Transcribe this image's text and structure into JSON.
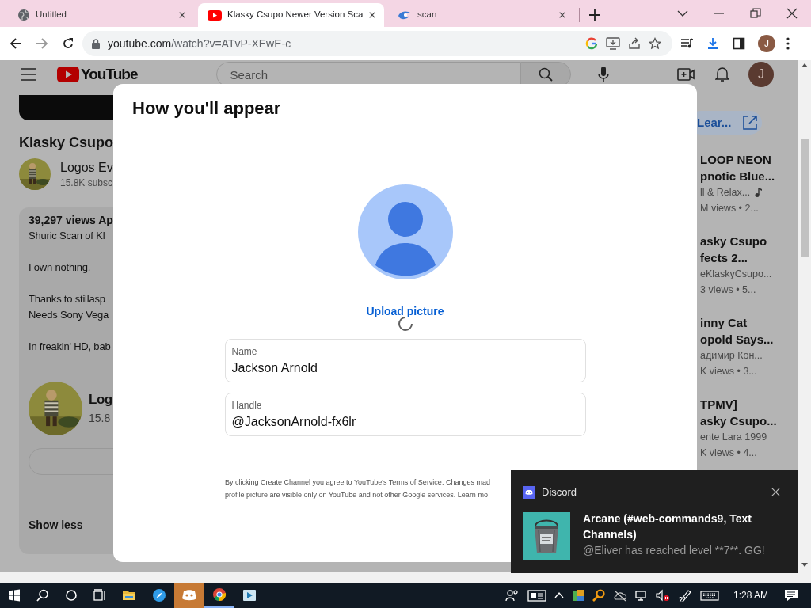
{
  "browser": {
    "tabs": [
      {
        "title": "Untitled",
        "kind": "globe",
        "selected": false
      },
      {
        "title": "Klasky Csupo Newer Version Sca",
        "kind": "youtube",
        "selected": true
      },
      {
        "title": "scan",
        "kind": "swirl",
        "selected": false
      }
    ],
    "url": {
      "host": "youtube.com",
      "path": "/watch?v=ATvP-XEwE-c"
    },
    "profile_initial": "J"
  },
  "youtube": {
    "logo": "YouTube",
    "search_placeholder": "Search",
    "avatar_initial": "J",
    "video_title": "Klasky Csupo",
    "channel": {
      "name": "Logos Ev",
      "subscribers": "15.8K subsc"
    },
    "description": {
      "stats": "39,297 views  Ap",
      "paragraphs": [
        [
          "Shuric Scan of Kl"
        ],
        [
          "I own nothing."
        ],
        [
          "Thanks to stillasp",
          "Needs Sony Vega"
        ],
        [
          "In freakin' HD, bab"
        ]
      ],
      "channel_name": "Log",
      "channel_subscribers": "15.8",
      "toggle": "Show less"
    },
    "learn_more": "Lear...",
    "recommendations": [
      {
        "title": [
          "LOOP NEON",
          "pnotic Blue..."
        ],
        "channel": "ll & Relax...",
        "music": true,
        "meta": "M views  • 2..."
      },
      {
        "title": [
          "asky Csupo",
          "fects 2..."
        ],
        "channel": "eKlaskyCsupo...",
        "music": false,
        "meta": "3 views  • 5..."
      },
      {
        "title": [
          "inny Cat",
          "opold Says..."
        ],
        "channel": "адимир Кон...",
        "music": false,
        "meta": "K views  • 3..."
      },
      {
        "title": [
          "TPMV]",
          "asky Csupo..."
        ],
        "channel": "ente Lara 1999",
        "music": false,
        "meta": "K views  • 4..."
      }
    ]
  },
  "dialog": {
    "title": "How you'll appear",
    "upload_label": "Upload picture",
    "uploading": true,
    "fields": [
      {
        "label": "Name",
        "value": "Jackson Arnold"
      },
      {
        "label": "Handle",
        "value": "@JacksonArnold-fx6lr"
      }
    ],
    "terms": [
      {
        "before": "By clicking Create Channel you agree to ",
        "link": "YouTube's Terms of Service",
        "after": ". Changes mad"
      },
      {
        "before": "profile picture are visible only on YouTube and not other Google services. ",
        "link": "Learn mo"
      }
    ]
  },
  "notification": {
    "app": "Discord",
    "title": "Arcane (#web-commands9, Text Channels)",
    "message": "@Eliver has reached level **7**. GG!"
  },
  "taskbar": {
    "apps": [
      {
        "kind": "folder",
        "flashing": false,
        "running": false
      },
      {
        "kind": "compass",
        "flashing": false,
        "running": false
      },
      {
        "kind": "discord",
        "flashing": true,
        "running": false
      },
      {
        "kind": "chrome",
        "flashing": false,
        "running": true
      },
      {
        "kind": "player",
        "flashing": false,
        "running": false
      }
    ],
    "time": "1:28 AM"
  }
}
